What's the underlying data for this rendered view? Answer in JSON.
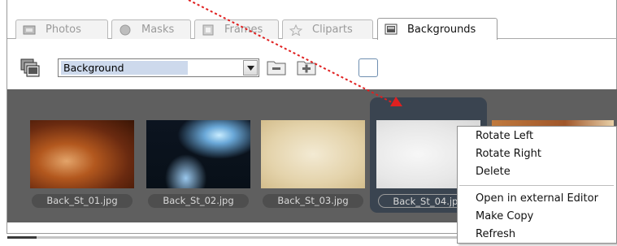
{
  "tabs": [
    {
      "label": "Photos",
      "icon": "photo-icon",
      "active": false
    },
    {
      "label": "Masks",
      "icon": "mask-icon",
      "active": false
    },
    {
      "label": "Frames",
      "icon": "frame-icon",
      "active": false
    },
    {
      "label": "Cliparts",
      "icon": "star-icon",
      "active": false
    },
    {
      "label": "Backgrounds",
      "icon": "background-icon",
      "active": true
    }
  ],
  "toolbar": {
    "category_select": "Background"
  },
  "thumbnails": [
    {
      "label": "Back_St_01.jpg",
      "selected": false
    },
    {
      "label": "Back_St_02.jpg",
      "selected": false
    },
    {
      "label": "Back_St_03.jpg",
      "selected": false
    },
    {
      "label": "Back_St_04.jpg",
      "selected": true
    }
  ],
  "context_menu": {
    "items": [
      "Rotate Left",
      "Rotate Right",
      "Delete",
      "Open in external Editor",
      "Make Copy",
      "Refresh"
    ]
  },
  "colors": {
    "annotation_arrow": "#e02020",
    "strip_background": "#5f5f5f",
    "selection_frame": "#3a4450",
    "select_highlight": "#cdd9ec"
  }
}
